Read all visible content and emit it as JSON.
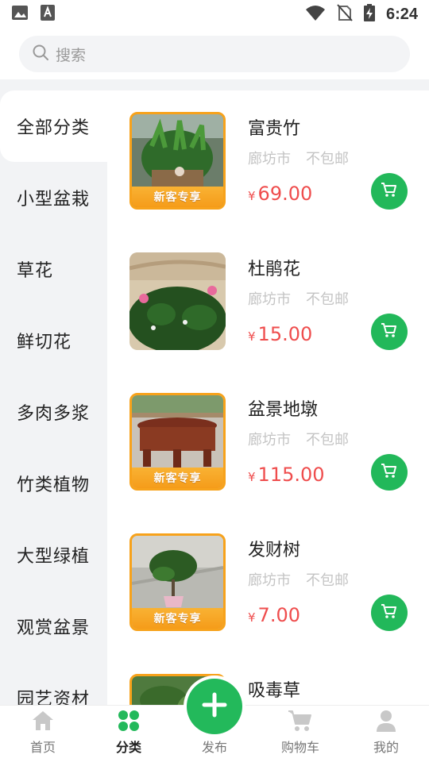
{
  "status_bar": {
    "time": "6:24"
  },
  "search": {
    "placeholder": "搜索"
  },
  "sidebar": {
    "items": [
      {
        "label": "全部分类",
        "active": true
      },
      {
        "label": "小型盆栽",
        "active": false
      },
      {
        "label": "草花",
        "active": false
      },
      {
        "label": "鲜切花",
        "active": false
      },
      {
        "label": "多肉多浆",
        "active": false
      },
      {
        "label": "竹类植物",
        "active": false
      },
      {
        "label": "大型绿植",
        "active": false
      },
      {
        "label": "观赏盆景",
        "active": false
      },
      {
        "label": "园艺资材",
        "active": false
      }
    ]
  },
  "products": [
    {
      "name": "富贵竹",
      "location": "廊坊市",
      "shipping": "不包邮",
      "currency": "¥",
      "price": "69.00",
      "promo": "新客专享"
    },
    {
      "name": "杜鹃花",
      "location": "廊坊市",
      "shipping": "不包邮",
      "currency": "¥",
      "price": "15.00",
      "promo": ""
    },
    {
      "name": "盆景地墩",
      "location": "廊坊市",
      "shipping": "不包邮",
      "currency": "¥",
      "price": "115.00",
      "promo": "新客专享"
    },
    {
      "name": "发财树",
      "location": "廊坊市",
      "shipping": "不包邮",
      "currency": "¥",
      "price": "7.00",
      "promo": "新客专享"
    },
    {
      "name": "吸毒草",
      "location": "",
      "shipping": "",
      "currency": "",
      "price": "",
      "promo": ""
    }
  ],
  "bottom_nav": {
    "home": "首页",
    "category": "分类",
    "publish": "发布",
    "cart": "购物车",
    "mine": "我的"
  },
  "colors": {
    "accent_green": "#22b85a",
    "price_red": "#ef4d4d",
    "promo_orange": "#f7a21b"
  }
}
